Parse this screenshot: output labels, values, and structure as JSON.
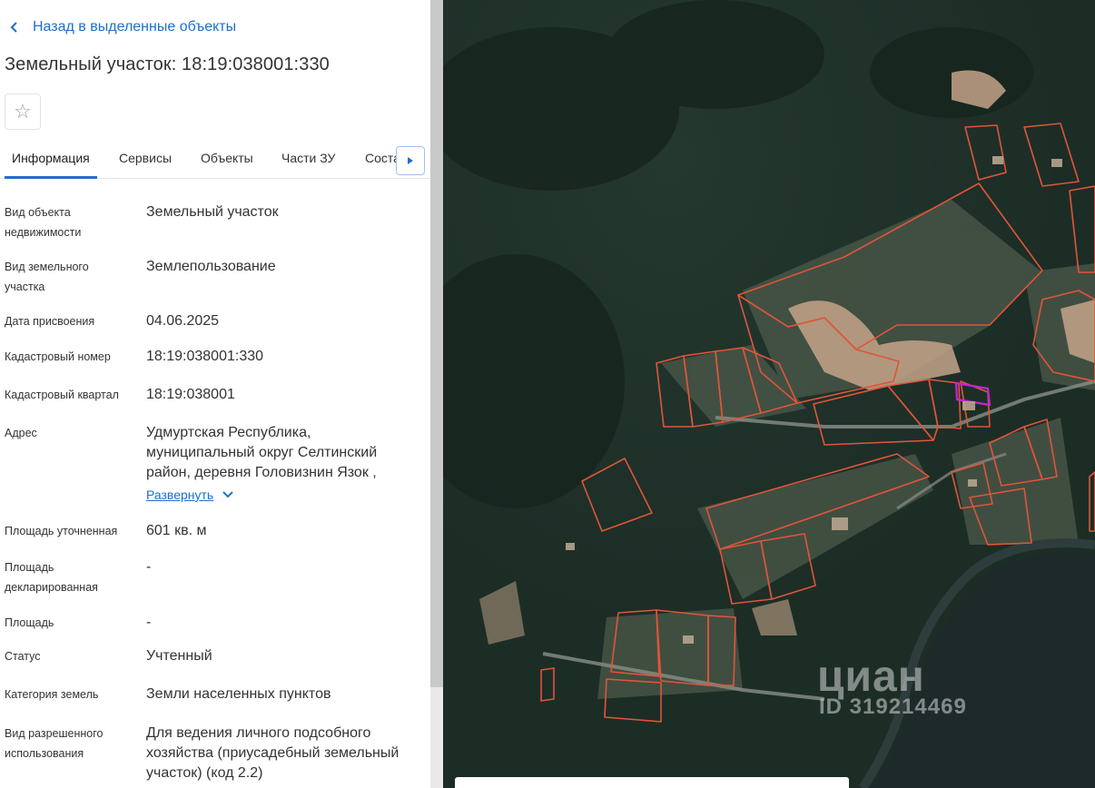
{
  "nav": {
    "back_label": "Назад в выделенные объекты"
  },
  "header": {
    "title": "Земельный участок: 18:19:038001:330",
    "favorite_icon": "star-icon"
  },
  "tabs": [
    {
      "label": "Информация",
      "active": true
    },
    {
      "label": "Сервисы",
      "active": false
    },
    {
      "label": "Объекты",
      "active": false
    },
    {
      "label": "Части ЗУ",
      "active": false
    },
    {
      "label": "Состав",
      "active": false
    }
  ],
  "details": [
    {
      "label": "Вид объекта недвижимости",
      "value": "Земельный участок"
    },
    {
      "label": "Вид земельного участка",
      "value": "Землепользование"
    },
    {
      "label": "Дата присвоения",
      "value": "04.06.2025"
    },
    {
      "label": "Кадастровый номер",
      "value": "18:19:038001:330"
    },
    {
      "label": "Кадастровый квартал",
      "value": "18:19:038001"
    },
    {
      "label": "Адрес",
      "value": "Удмуртская Республика, муниципальный округ Селтинский район, деревня Головизнин Язок ,",
      "expand_label": "Развернуть"
    },
    {
      "label": "Площадь уточненная",
      "value": "601 кв. м"
    },
    {
      "label": "Площадь декларированная",
      "value": "-"
    },
    {
      "label": "Площадь",
      "value": "-"
    },
    {
      "label": "Статус",
      "value": "Учтенный"
    },
    {
      "label": "Категория земель",
      "value": "Земли населенных пунктов"
    },
    {
      "label": "Вид разрешенного использования",
      "value": "Для ведения личного подсобного хозяйства (приусадебный земельный участок) (код 2.2)"
    }
  ],
  "map": {
    "watermark": "циан",
    "watermark_id": "ID 319214469",
    "parcel_color": "#e0553a",
    "selected_parcel_color": "#c026d3"
  }
}
